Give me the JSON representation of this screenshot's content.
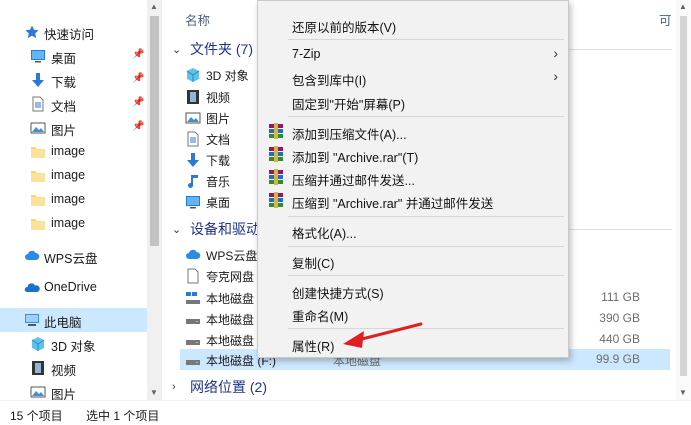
{
  "nav": {
    "quick_access": "快速访问",
    "items": [
      {
        "label": "桌面",
        "pinned": true
      },
      {
        "label": "下载",
        "pinned": true
      },
      {
        "label": "文档",
        "pinned": true
      },
      {
        "label": "图片",
        "pinned": true
      },
      {
        "label": "image",
        "pinned": false
      },
      {
        "label": "image",
        "pinned": false
      },
      {
        "label": "image",
        "pinned": false
      },
      {
        "label": "image",
        "pinned": false
      }
    ],
    "wps": "WPS云盘",
    "onedrive": "OneDrive",
    "this_pc": "此电脑",
    "pc_children": [
      "3D 对象",
      "视频",
      "图片"
    ],
    "pin_glyph": "📌"
  },
  "main": {
    "header_name": "名称",
    "header_right": "可",
    "group_folders": "文件夹 (7)",
    "folders": [
      "3D 对象",
      "视频",
      "图片",
      "文档",
      "下载",
      "音乐",
      "桌面"
    ],
    "group_devices": "设备和驱动器",
    "devices": [
      {
        "name": "WPS云盘",
        "type": "",
        "size": ""
      },
      {
        "name": "夸克网盘",
        "type": "",
        "size": ""
      },
      {
        "name": "本地磁盘",
        "type": "",
        "size": "111 GB"
      },
      {
        "name": "本地磁盘",
        "type": "",
        "size": "390 GB"
      },
      {
        "name": "本地磁盘",
        "type": "",
        "size": "440 GB"
      },
      {
        "name": "本地磁盘 (F:)",
        "type": "本地磁盘",
        "size": "99.9 GB"
      }
    ],
    "group_network": "网络位置 (2)"
  },
  "status": {
    "count": "15 个项目",
    "selected": "选中 1 个项目"
  },
  "context_menu": {
    "items": [
      {
        "label": "还原以前的版本(V)"
      },
      {
        "label": "7-Zip",
        "submenu": true
      },
      {
        "label": "包含到库中(I)",
        "submenu": true
      },
      {
        "label": "固定到\"开始\"屏幕(P)"
      },
      {
        "label": "添加到压缩文件(A)...",
        "icon": "winrar-icon"
      },
      {
        "label": "添加到 \"Archive.rar\"(T)",
        "icon": "winrar-icon"
      },
      {
        "label": "压缩并通过邮件发送...",
        "icon": "winrar-icon"
      },
      {
        "label": "压缩到 \"Archive.rar\" 并通过邮件发送",
        "icon": "winrar-icon"
      },
      {
        "label": "格式化(A)..."
      },
      {
        "label": "复制(C)"
      },
      {
        "label": "创建快捷方式(S)"
      },
      {
        "label": "重命名(M)"
      },
      {
        "label": "属性(R)"
      }
    ],
    "submenu_glyph": "›"
  },
  "colors": {
    "selection": "#cce8ff",
    "group_header": "#1e3287",
    "annotation_arrow": "#e02020"
  }
}
